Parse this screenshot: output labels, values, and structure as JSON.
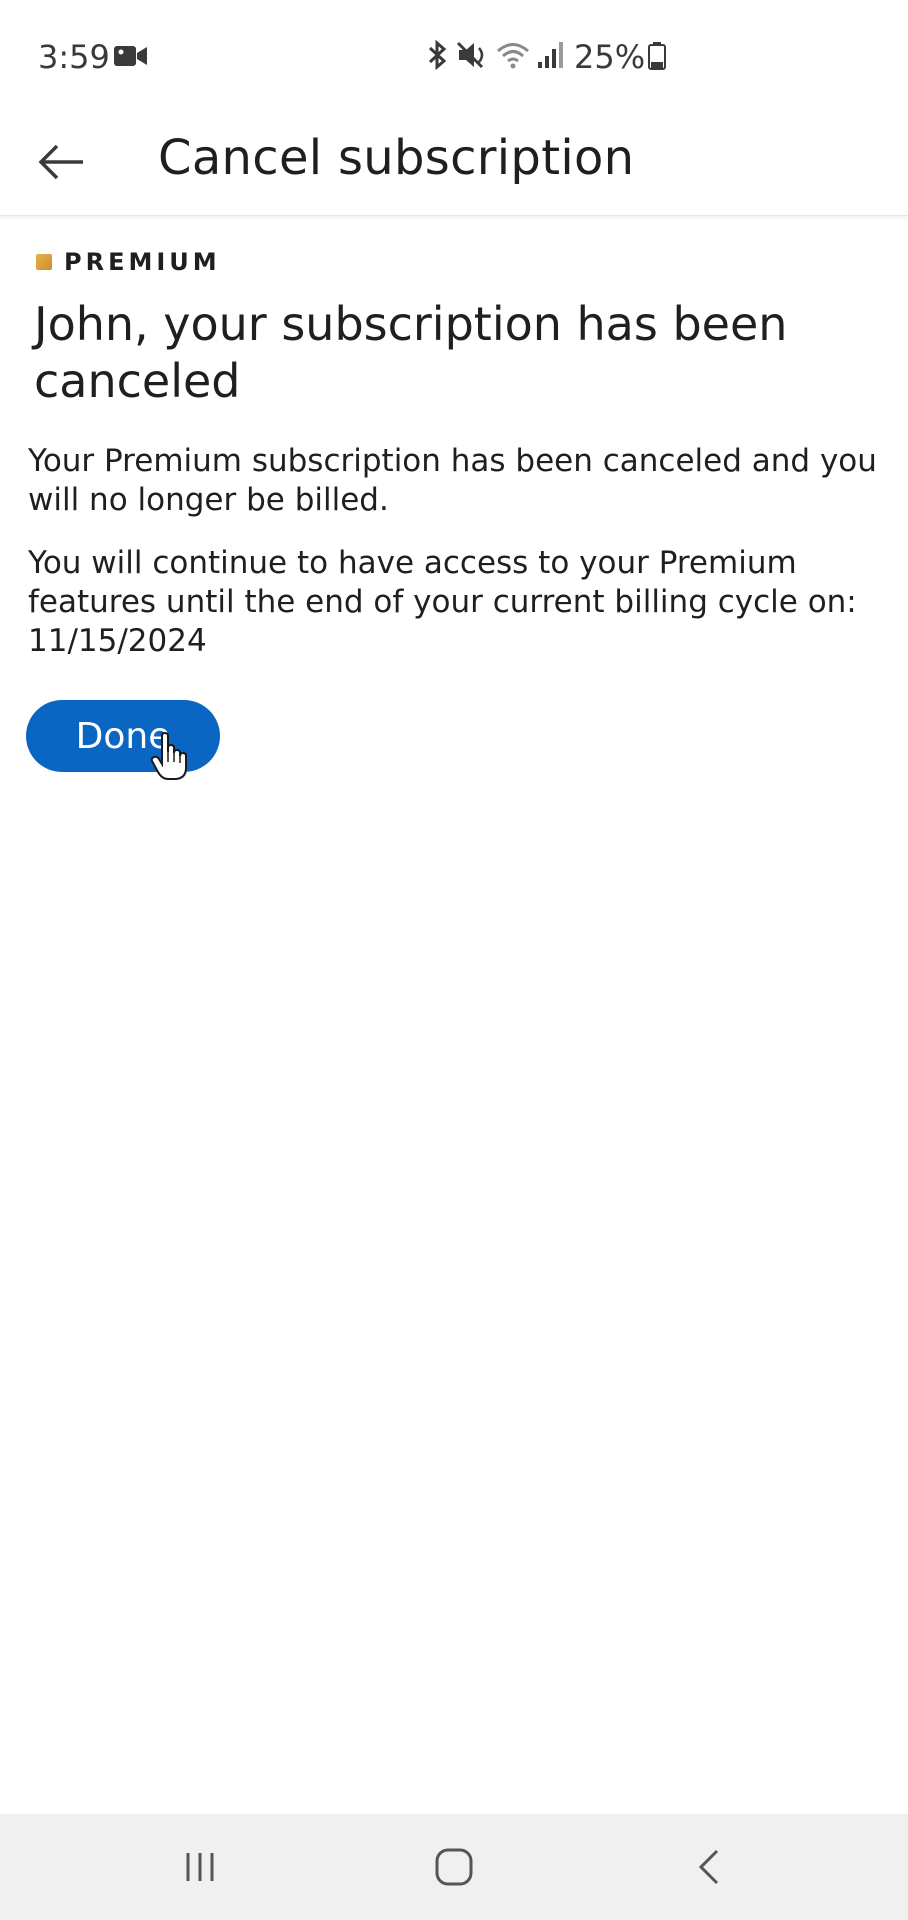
{
  "status_bar": {
    "time": "3:59",
    "battery": "25%",
    "icons": [
      "video-camera-icon",
      "bluetooth-icon",
      "mute-icon",
      "wifi-icon",
      "signal-icon",
      "battery-icon"
    ]
  },
  "app_bar": {
    "title": "Cancel subscription",
    "back_icon": "arrow-left-icon"
  },
  "content": {
    "badge_label": "PREMIUM",
    "headline": "John, your subscription has been canceled",
    "paragraph_1": "Your Premium subscription has been canceled and you will no longer be billed.",
    "paragraph_2": "You will continue to have access to your Premium features until the end of your current billing cycle on: 11/15/2024",
    "done_label": "Done"
  },
  "nav_bar": {
    "icons": [
      "recent-apps-icon",
      "home-icon",
      "back-icon"
    ]
  },
  "colors": {
    "primary_button": "#0a66c2",
    "premium_gold": "#d9a13a",
    "nav_background": "#f0f0f0"
  }
}
